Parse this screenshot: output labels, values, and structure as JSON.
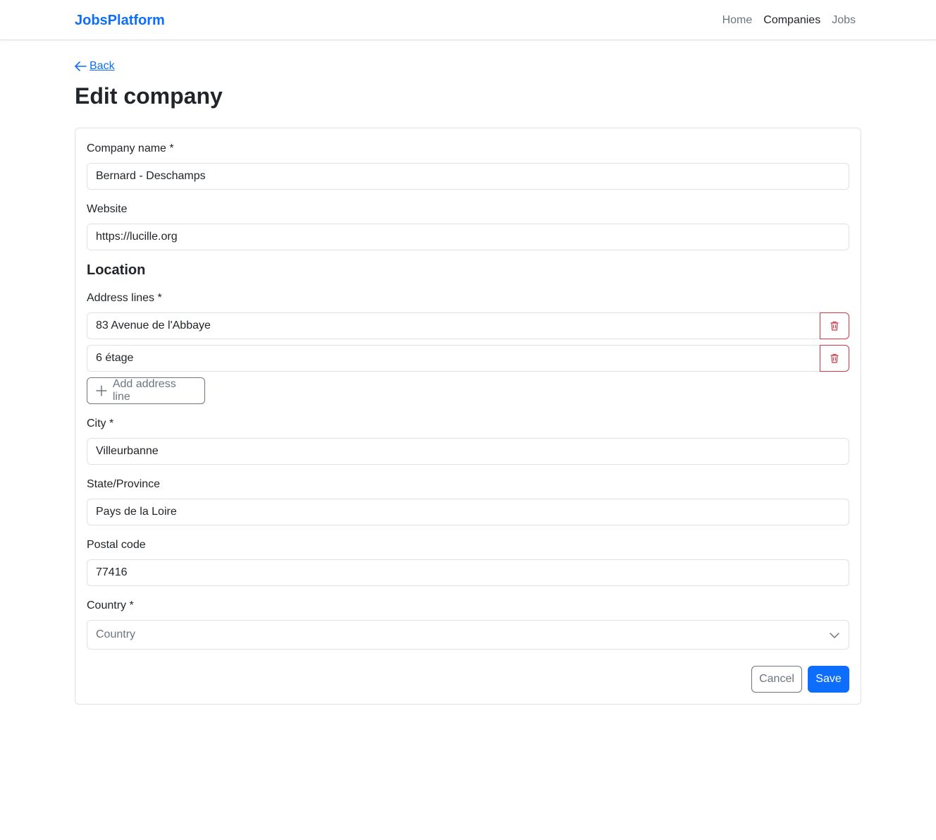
{
  "nav": {
    "brand": "JobsPlatform",
    "links": [
      "Home",
      "Companies",
      "Jobs"
    ],
    "active": "Companies"
  },
  "page": {
    "back_label": "Back",
    "title": "Edit company"
  },
  "form": {
    "company_name": {
      "label": "Company name *",
      "value": "Bernard - Deschamps"
    },
    "website": {
      "label": "Website",
      "value": "https://lucille.org"
    },
    "location_title": "Location",
    "address_lines": {
      "label": "Address lines *",
      "values": [
        "83 Avenue de l'Abbaye",
        "6 étage"
      ],
      "add_label": "Add address line"
    },
    "city": {
      "label": "City *",
      "value": "Villeurbanne"
    },
    "state": {
      "label": "State/Province",
      "value": "Pays de la Loire"
    },
    "postal_code": {
      "label": "Postal code",
      "value": "77416"
    },
    "country": {
      "label": "Country *",
      "placeholder": "Country"
    },
    "cancel_label": "Cancel",
    "save_label": "Save"
  },
  "colors": {
    "primary": "#0d6efd",
    "danger": "#dc3545",
    "secondary": "#6c757d"
  },
  "icons": [
    "arrow-left-icon",
    "trash-icon",
    "plus-icon",
    "chevron-down-icon"
  ]
}
